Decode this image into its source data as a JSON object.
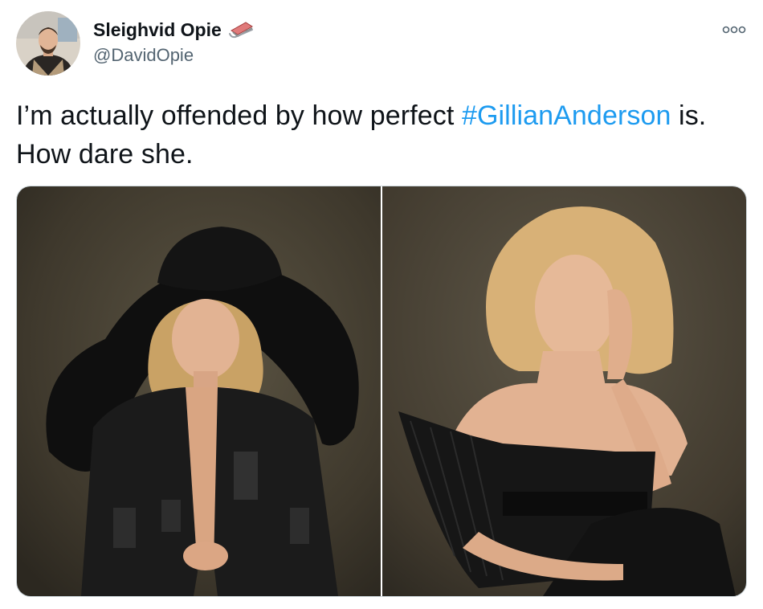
{
  "tweet": {
    "author": {
      "display_name": "Sleighvid Opie",
      "handle": "@DavidOpie",
      "name_emoji_icon": "sled-icon",
      "avatar_icon": "profile-photo"
    },
    "more_icon": "more-options-icon",
    "text": {
      "before": "I’m actually offended by how perfect ",
      "hashtag": "#GillianAnderson",
      "after": " is. How dare she."
    },
    "media": [
      {
        "name": "photo-woman-wide-black-hat"
      },
      {
        "name": "photo-woman-pleated-strapless-top"
      }
    ],
    "colors": {
      "link": "#1d9bf0",
      "secondary_text": "#536471",
      "border": "#cfd9de"
    }
  }
}
